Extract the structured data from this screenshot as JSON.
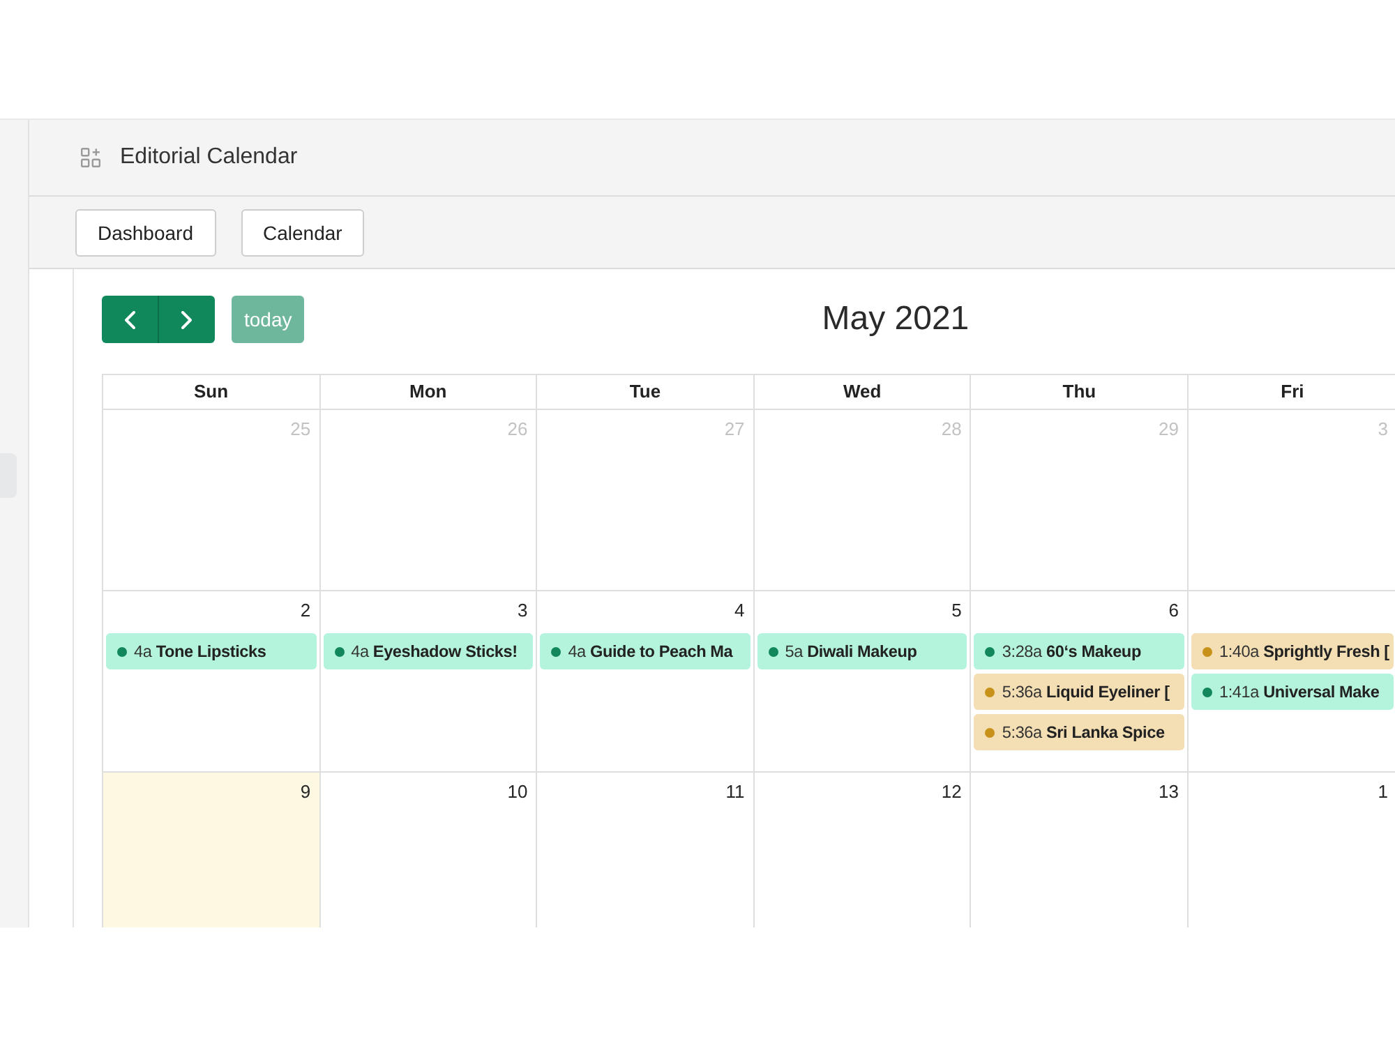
{
  "header": {
    "title": "Editorial Calendar"
  },
  "toolbar": {
    "buttons": [
      {
        "label": "Dashboard"
      },
      {
        "label": "Calendar"
      }
    ]
  },
  "calendar": {
    "today_button": {
      "label": "today",
      "disabled": true
    },
    "title": "May 2021",
    "weekdays": [
      "Sun",
      "Mon",
      "Tue",
      "Wed",
      "Thu",
      "Fri"
    ],
    "weeks": [
      {
        "days": [
          {
            "number": "25",
            "other_month": true,
            "today": false
          },
          {
            "number": "26",
            "other_month": true,
            "today": false
          },
          {
            "number": "27",
            "other_month": true,
            "today": false
          },
          {
            "number": "28",
            "other_month": true,
            "today": false
          },
          {
            "number": "29",
            "other_month": true,
            "today": false
          },
          {
            "number": "3",
            "other_month": true,
            "today": false
          }
        ]
      },
      {
        "days": [
          {
            "number": "2",
            "other_month": false,
            "today": false,
            "events": [
              {
                "time": "4a",
                "title": "Tone Lipsticks",
                "color": "#12875c"
              }
            ]
          },
          {
            "number": "3",
            "other_month": false,
            "today": false,
            "events": [
              {
                "time": "4a",
                "title": "Eyeshadow Sticks!",
                "color": "#12875c"
              }
            ]
          },
          {
            "number": "4",
            "other_month": false,
            "today": false,
            "events": [
              {
                "time": "4a",
                "title": "Guide to Peach Ma",
                "color": "#12875c"
              }
            ]
          },
          {
            "number": "5",
            "other_month": false,
            "today": false,
            "events": [
              {
                "time": "5a",
                "title": "Diwali Makeup",
                "color": "#12875c"
              }
            ]
          },
          {
            "number": "6",
            "other_month": false,
            "today": false,
            "events": [
              {
                "time": "3:28a",
                "title": "60‘s Makeup",
                "color": "#12875c"
              },
              {
                "time": "5:36a",
                "title": "Liquid Eyeliner [",
                "color": "#c8921a"
              },
              {
                "time": "5:36a",
                "title": "Sri Lanka Spice",
                "color": "#c8921a"
              }
            ]
          },
          {
            "today": false,
            "events": [
              {
                "time": "1:40a",
                "title": "Sprightly Fresh [",
                "color": "#c8921a"
              },
              {
                "time": "1:41a",
                "title": "Universal Make",
                "color": "#12875c"
              }
            ]
          }
        ]
      },
      {
        "days": [
          {
            "number": "9",
            "other_month": false,
            "today": true
          },
          {
            "number": "10",
            "other_month": false,
            "today": false
          },
          {
            "number": "11",
            "other_month": false,
            "today": false
          },
          {
            "number": "12",
            "other_month": false,
            "today": false
          },
          {
            "number": "13",
            "other_month": false,
            "today": false
          },
          {
            "number": "1",
            "other_month": false,
            "today": false
          }
        ]
      }
    ]
  }
}
